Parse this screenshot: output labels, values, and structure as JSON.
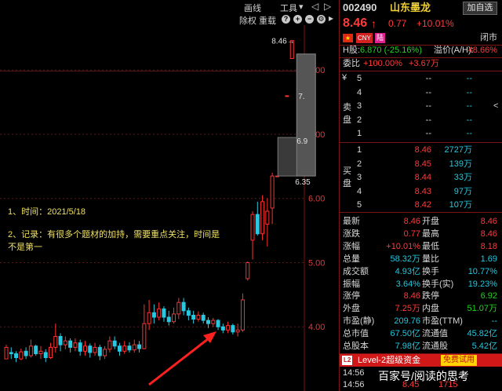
{
  "toolbar": {
    "draw_line": "画线",
    "tools": "工具",
    "tools_caret": "▾",
    "exclude_rights": "除权",
    "overlay": "重载"
  },
  "chart_data": {
    "type": "candlestick",
    "ylim": [
      3.0,
      8.7
    ],
    "yticks": [
      "8.00",
      "7.00",
      "6.00",
      "5.00",
      "4.00"
    ],
    "candles": [
      [
        3.5,
        3.68,
        3.55,
        3.72
      ],
      [
        3.6,
        3.58,
        3.5,
        3.68
      ],
      [
        3.58,
        3.52,
        3.45,
        3.62
      ],
      [
        3.5,
        3.61,
        3.48,
        3.66
      ],
      [
        3.62,
        3.55,
        3.5,
        3.68
      ],
      [
        3.55,
        3.7,
        3.52,
        3.8
      ],
      [
        3.7,
        3.58,
        3.55,
        3.72
      ],
      [
        3.58,
        3.62,
        3.5,
        3.7
      ],
      [
        3.6,
        3.52,
        3.45,
        3.65
      ],
      [
        3.52,
        3.68,
        3.5,
        3.75
      ],
      [
        3.68,
        3.85,
        3.6,
        4.05
      ],
      [
        3.85,
        3.72,
        3.62,
        3.9
      ],
      [
        3.72,
        3.78,
        3.65,
        3.85
      ],
      [
        3.78,
        3.68,
        3.6,
        3.82
      ],
      [
        3.68,
        3.75,
        3.62,
        3.82
      ],
      [
        3.75,
        3.62,
        3.55,
        3.8
      ],
      [
        3.62,
        3.7,
        3.55,
        3.78
      ],
      [
        3.7,
        3.6,
        3.52,
        3.74
      ],
      [
        3.6,
        3.68,
        3.55,
        3.75
      ],
      [
        3.68,
        3.55,
        3.48,
        3.72
      ],
      [
        3.55,
        3.65,
        3.5,
        3.7
      ],
      [
        3.65,
        3.78,
        3.6,
        3.85
      ],
      [
        3.78,
        3.7,
        3.65,
        3.85
      ],
      [
        3.7,
        3.62,
        3.55,
        3.75
      ],
      [
        3.62,
        3.7,
        3.58,
        3.78
      ],
      [
        3.7,
        3.64,
        3.6,
        3.76
      ],
      [
        3.64,
        3.72,
        3.6,
        3.8
      ],
      [
        3.72,
        3.66,
        3.6,
        3.78
      ],
      [
        3.66,
        4.05,
        3.65,
        4.35
      ],
      [
        4.05,
        4.22,
        3.95,
        4.42
      ],
      [
        4.22,
        4.15,
        4.05,
        4.35
      ],
      [
        4.15,
        4.28,
        4.1,
        4.38
      ],
      [
        4.28,
        4.15,
        4.08,
        4.32
      ],
      [
        4.15,
        4.08,
        4.02,
        4.25
      ],
      [
        4.08,
        4.2,
        4.05,
        4.3
      ],
      [
        4.2,
        4.38,
        4.12,
        4.45
      ],
      [
        4.38,
        4.25,
        4.18,
        4.45
      ],
      [
        4.25,
        4.18,
        4.1,
        4.3
      ],
      [
        4.18,
        4.12,
        4.05,
        4.25
      ],
      [
        4.12,
        4.18,
        4.08,
        4.24
      ],
      [
        4.18,
        4.1,
        4.05,
        4.22
      ],
      [
        4.1,
        4.05,
        3.98,
        4.15
      ],
      [
        4.05,
        4.1,
        4.0,
        4.14
      ],
      [
        4.1,
        4.0,
        3.95,
        4.12
      ],
      [
        4.0,
        3.95,
        3.9,
        4.05
      ],
      [
        3.95,
        4.02,
        3.9,
        4.08
      ],
      [
        4.02,
        3.92,
        3.88,
        4.05
      ],
      [
        3.92,
        3.95,
        3.85,
        4.05
      ],
      [
        3.95,
        4.42,
        3.92,
        4.52
      ],
      [
        4.75,
        5.0,
        4.72,
        5.02
      ],
      [
        5.35,
        5.75,
        5.05,
        5.8
      ],
      [
        5.75,
        5.45,
        5.42,
        5.95
      ],
      [
        5.45,
        5.95,
        5.35,
        6.05
      ],
      [
        5.6,
        5.8,
        5.25,
        6.0
      ],
      [
        5.85,
        6.35,
        5.6,
        6.4
      ],
      [
        6.35,
        6.35,
        6.35,
        6.35
      ],
      [
        6.9,
        6.9,
        6.9,
        6.9
      ],
      [
        7.6,
        7.6,
        7.6,
        7.6
      ],
      [
        8.18,
        8.46,
        8.18,
        8.46
      ]
    ],
    "price_labels": {
      "high": "8.46→",
      "l1": "7.",
      "l2": "6.9",
      "l3": "6.35"
    }
  },
  "annotation": {
    "line1": "1、时间：2021/5/18",
    "line2": "2、记录：有很多个题材的加持，需要重点关注，时间是",
    "line3": "不是第一"
  },
  "stock": {
    "code": "002490",
    "name": "山东墨龙",
    "add_button": "加自选",
    "price": "8.46",
    "arrow": "↑",
    "change": "0.77",
    "change_pct": "+10.01%",
    "tag_cny": "CNY",
    "tag_lu": "陆",
    "status": "闭市",
    "h_label": "H股:",
    "h_value": "6.870 (-25.16%)",
    "premium_label": "溢价(A/H):",
    "premium_value": "48.66%",
    "wb_label": "委比",
    "wb_value": "+100.00%",
    "wc_value": "+3.67万"
  },
  "sell": {
    "label": "卖盘",
    "rows": [
      {
        "n": "5",
        "p": "--",
        "v": "--"
      },
      {
        "n": "4",
        "p": "--",
        "v": "--"
      },
      {
        "n": "3",
        "p": "--",
        "v": "--"
      },
      {
        "n": "2",
        "p": "--",
        "v": "--"
      },
      {
        "n": "1",
        "p": "--",
        "v": "--"
      }
    ]
  },
  "buy": {
    "label": "买盘",
    "rows": [
      {
        "n": "1",
        "p": "8.46",
        "v": "2727万"
      },
      {
        "n": "2",
        "p": "8.45",
        "v": "139万"
      },
      {
        "n": "3",
        "p": "8.44",
        "v": "33万"
      },
      {
        "n": "4",
        "p": "8.43",
        "v": "97万"
      },
      {
        "n": "5",
        "p": "8.42",
        "v": "107万"
      }
    ]
  },
  "stats": [
    {
      "k1": "最新",
      "v1": "8.46",
      "c1": "red",
      "k2": "开盘",
      "v2": "8.46",
      "c2": "red"
    },
    {
      "k1": "涨跌",
      "v1": "0.77",
      "c1": "red",
      "k2": "最高",
      "v2": "8.46",
      "c2": "red"
    },
    {
      "k1": "涨幅",
      "v1": "+10.01%",
      "c1": "red",
      "k2": "最低",
      "v2": "8.18",
      "c2": "red"
    },
    {
      "k1": "总量",
      "v1": "58.32万",
      "c1": "cyan",
      "k2": "量比",
      "v2": "1.69",
      "c2": "cyan"
    },
    {
      "k1": "成交额",
      "v1": "4.93亿",
      "c1": "cyan",
      "k2": "换手",
      "v2": "10.77%",
      "c2": "cyan"
    },
    {
      "k1": "振幅",
      "v1": "3.64%",
      "c1": "cyan",
      "k2": "换手(实)",
      "v2": "19.23%",
      "c2": "cyan"
    },
    {
      "k1": "涨停",
      "v1": "8.46",
      "c1": "red",
      "k2": "跌停",
      "v2": "6.92",
      "c2": "green"
    },
    {
      "k1": "外盘",
      "v1": "7.25万",
      "c1": "red",
      "k2": "内盘",
      "v2": "51.07万",
      "c2": "green"
    },
    {
      "k1": "市盈(静)",
      "v1": "209.76",
      "c1": "cyan",
      "k2": "市盈(TTM)",
      "v2": "--",
      "c2": "cyan"
    },
    {
      "k1": "总市值",
      "v1": "67.50亿",
      "c1": "cyan",
      "k2": "流通值",
      "v2": "45.82亿",
      "c2": "cyan"
    },
    {
      "k1": "总股本",
      "v1": "7.98亿",
      "c1": "cyan",
      "k2": "流通股",
      "v2": "5.42亿",
      "c2": "cyan"
    }
  ],
  "banner": {
    "badge": "L2",
    "text": "Level-2超级资金",
    "trial": "免费试用"
  },
  "ticks": [
    {
      "t": "14:56",
      "p": "",
      "v": ""
    },
    {
      "t": "14:56",
      "p": "8.45",
      "v": "1715"
    }
  ],
  "watermark": "百家号/阅读的思考"
}
